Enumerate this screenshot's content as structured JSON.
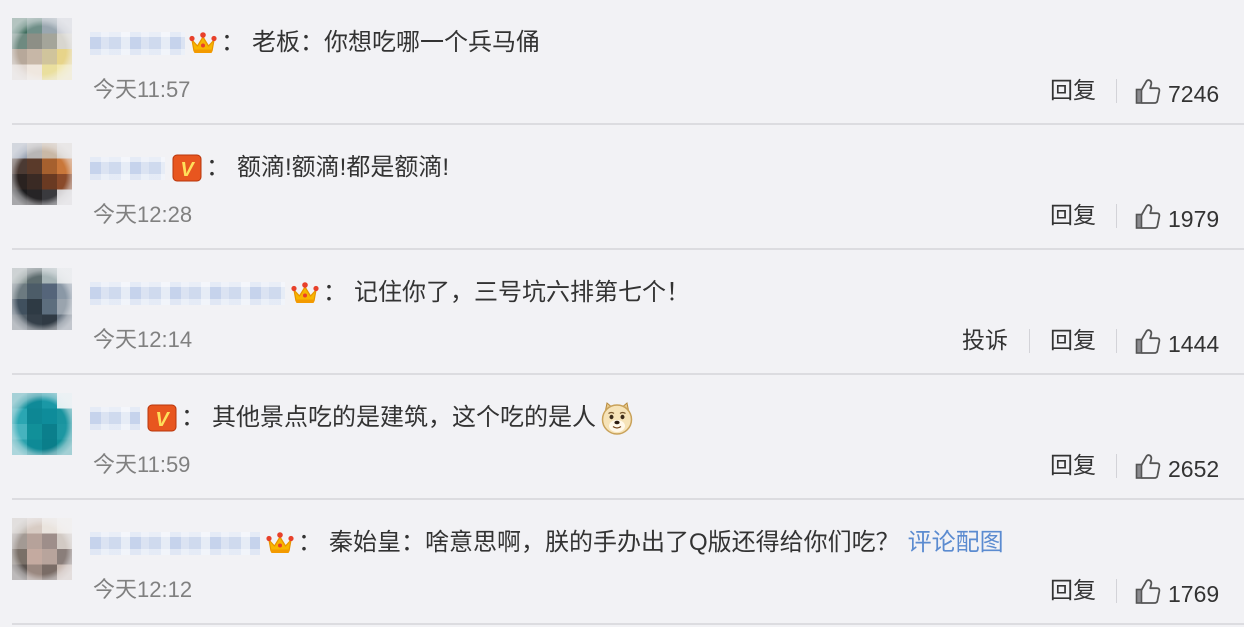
{
  "colors": {
    "background": "#f2f2f5",
    "text": "#333333",
    "time": "#808080",
    "link": "#5b8bd0",
    "divider": "#dcdce0",
    "vip_crown": "#f8b600",
    "verified_badge": "#e8561f"
  },
  "comments": [
    {
      "badge_icon": "crown-icon",
      "separator": "：",
      "text": "老板：你想吃哪一个兵马俑",
      "time": "今天11:57",
      "reply_label": "回复",
      "like_icon": "thumb-up-icon",
      "likes": 7246
    },
    {
      "badge_icon": "verified-v-icon",
      "badge_label": "V",
      "separator": "：",
      "text": "额滴!额滴!都是额滴!",
      "time": "今天12:28",
      "reply_label": "回复",
      "like_icon": "thumb-up-icon",
      "likes": 1979
    },
    {
      "badge_icon": "crown-icon",
      "separator": "：",
      "text": "记住你了，三号坑六排第七个！",
      "time": "今天12:14",
      "report_label": "投诉",
      "reply_label": "回复",
      "like_icon": "thumb-up-icon",
      "likes": 1444
    },
    {
      "badge_icon": "verified-v-icon",
      "badge_label": "V",
      "separator": "：",
      "text": "其他景点吃的是建筑，这个吃的是人",
      "emoji_icon": "doge-emoji-icon",
      "time": "今天11:59",
      "reply_label": "回复",
      "like_icon": "thumb-up-icon",
      "likes": 2652
    },
    {
      "badge_icon": "crown-icon",
      "separator": "：",
      "text": "秦始皇：啥意思啊，朕的手办出了Q版还得给你们吃？",
      "link_text": "评论配图",
      "time": "今天12:12",
      "reply_label": "回复",
      "like_icon": "thumb-up-icon",
      "likes": 1769
    }
  ]
}
